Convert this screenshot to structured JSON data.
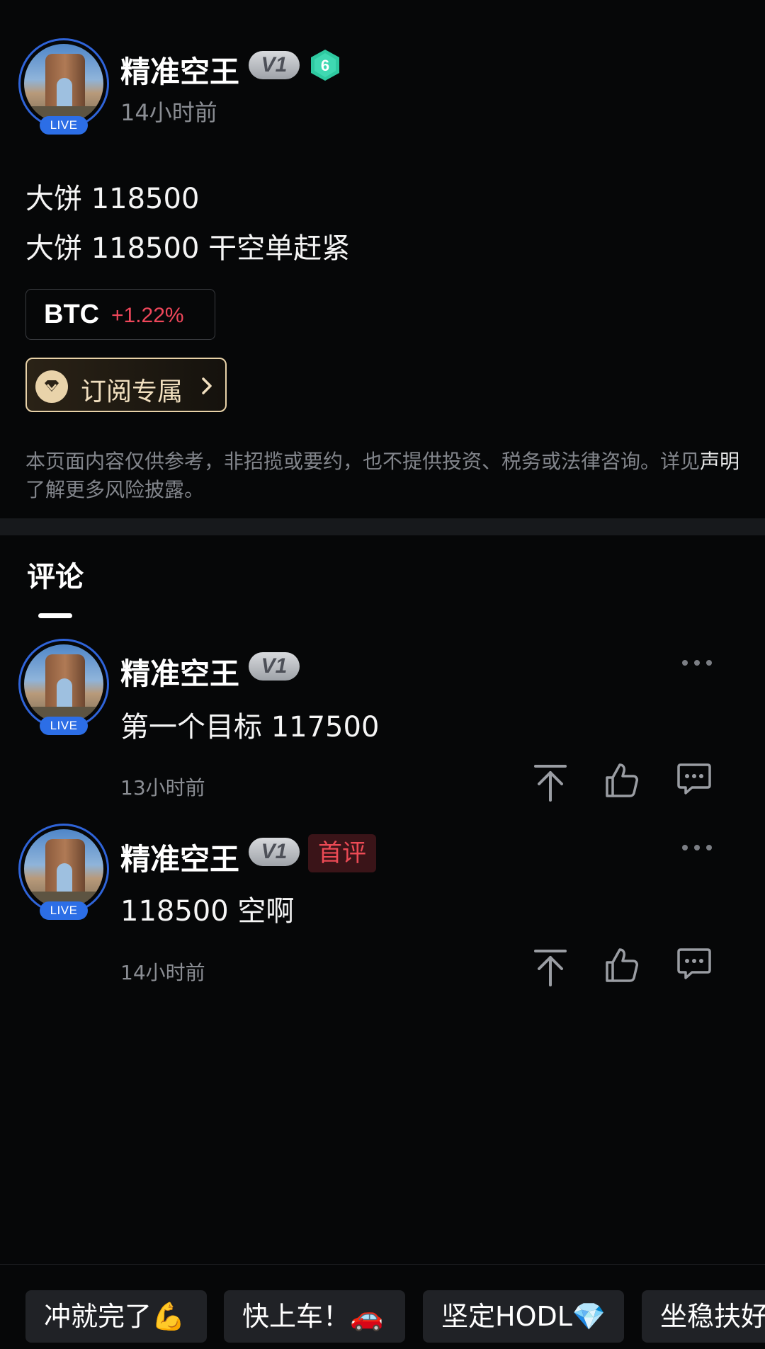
{
  "post": {
    "author": "精准空王",
    "vip_badge": "V1",
    "level": "6",
    "time": "14小时前",
    "live_label": "LIVE",
    "lines": [
      "大饼 118500",
      "大饼 118500 干空单赶紧"
    ],
    "ticker": {
      "symbol": "BTC",
      "change": "+1.22%"
    },
    "subscribe_label": "订阅专属",
    "disclaimer_pre": "本页面内容仅供参考，非招揽或要约，也不提供投资、税务或法律咨询。详见",
    "disclaimer_link": "声明",
    "disclaimer_post": "了解更多风险披露。"
  },
  "comments_tab": "评论",
  "comments": [
    {
      "author": "精准空王",
      "vip_badge": "V1",
      "live_label": "LIVE",
      "text": "第一个目标 117500",
      "time": "13小时前"
    },
    {
      "author": "精准空王",
      "vip_badge": "V1",
      "live_label": "LIVE",
      "badge": "首评",
      "text": "118500 空啊",
      "time": "14小时前"
    }
  ],
  "quick_replies": [
    "冲就完了💪",
    "快上车！🚗",
    "坚定HODL💎",
    "坐稳扶好"
  ],
  "colors": {
    "positive": "#f0475b",
    "live": "#2c6ee6",
    "level_badge": "#2ec9a0",
    "subscribe_gold": "#e8d2a8"
  },
  "icons": [
    "pin-top-icon",
    "thumbs-up-icon",
    "comment-icon",
    "more-icon",
    "chevron-right-icon",
    "diamond-icon"
  ]
}
